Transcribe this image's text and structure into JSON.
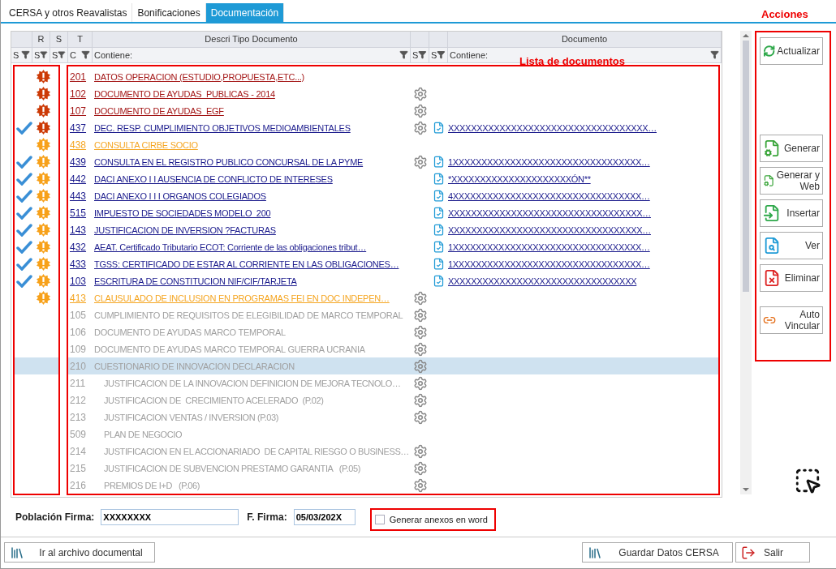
{
  "tabs": [
    {
      "label": "CERSA y otros Reavalistas",
      "selected": false
    },
    {
      "label": "Bonificaciones",
      "selected": false
    },
    {
      "label": "Documentación",
      "selected": true
    }
  ],
  "annotations": {
    "actions": "Acciones",
    "list": "Lista de documentos"
  },
  "table": {
    "columns": [
      {
        "sub": "S"
      },
      {
        "top": "R",
        "sub": "S"
      },
      {
        "top": "S",
        "sub": "S"
      },
      {
        "top": "T",
        "sub": "C"
      },
      {
        "top": "Descri Tipo Documento",
        "sub": "Contiene:"
      },
      {
        "sub": "S"
      },
      {
        "sub": "S"
      },
      {
        "top": "Documento",
        "sub": "Contiene:"
      }
    ],
    "rows": [
      {
        "checked": false,
        "alert": {
          "color": "#cc3a06"
        },
        "code": "201",
        "description": "DATOS OPERACION (ESTUDIO,PROPUESTA,ETC...)",
        "kind": "missing",
        "gear": false,
        "selected": false
      },
      {
        "checked": false,
        "alert": {
          "color": "#cc3a06"
        },
        "code": "102",
        "description": "DOCUMENTO DE AYUDAS  PUBLICAS - 2014",
        "kind": "missing",
        "gear": true,
        "selected": false
      },
      {
        "checked": false,
        "alert": {
          "color": "#cc3a06"
        },
        "code": "107",
        "description": "DOCUMENTO DE AYUDAS  EGF",
        "kind": "missing",
        "gear": true,
        "selected": false
      },
      {
        "checked": true,
        "alert": {
          "color": "#cc3a06"
        },
        "code": "437",
        "description": "DEC. RESP. CUMPLIMIENTO OBJETIVOS MEDIOAMBIENTALES",
        "kind": "received",
        "gear": true,
        "document": "XXXXXXXXXXXXXXXXXXXXXXXXXXXXXXXXXXX…",
        "selected": false
      },
      {
        "checked": false,
        "alert": {
          "color": "#f7a11a"
        },
        "code": "438",
        "description": "CONSULTA CIRBE SOCIO",
        "kind": "pending",
        "gear": false,
        "selected": false
      },
      {
        "checked": true,
        "alert": {
          "color": "#f7a11a"
        },
        "code": "439",
        "description": "CONSULTA EN EL REGISTRO PUBLICO CONCURSAL DE LA PYME",
        "kind": "received",
        "gear": true,
        "document": "1XXXXXXXXXXXXXXXXXXXXXXXXXXXXXXXXX…",
        "selected": false
      },
      {
        "checked": true,
        "alert": {
          "color": "#f7a11a"
        },
        "code": "442",
        "description": "DACI ANEXO I I AUSENCIA DE CONFLICTO DE INTERESES",
        "kind": "received",
        "gear": false,
        "document": "*XXXXXXXXXXXXXXXXXXXXXÓN**",
        "selected": false
      },
      {
        "checked": true,
        "alert": {
          "color": "#f7a11a"
        },
        "code": "443",
        "description": "DACI ANEXO I I I ORGANOS COLEGIADOS",
        "kind": "received",
        "gear": false,
        "document": "4XXXXXXXXXXXXXXXXXXXXXXXXXXXXXXXXX…",
        "selected": false
      },
      {
        "checked": true,
        "alert": {
          "color": "#f7a11a"
        },
        "code": "515",
        "description": "IMPUESTO DE SOCIEDADES MODELO  200",
        "kind": "received",
        "gear": false,
        "document": "XXXXXXXXXXXXXXXXXXXXXXXXXXXXXXXXXX…",
        "selected": false
      },
      {
        "checked": true,
        "alert": {
          "color": "#f7a11a"
        },
        "code": "143",
        "description": "JUSTIFICACION DE INVERSION ?FACTURAS",
        "kind": "received",
        "gear": false,
        "document": "XXXXXXXXXXXXXXXXXXXXXXXXXXXXXXXXXX…",
        "selected": false
      },
      {
        "checked": true,
        "alert": {
          "color": "#f7a11a"
        },
        "code": "432",
        "description": "AEAT. Certificado Tributario ECOT: Corriente de las obligaciones tribut…",
        "kind": "received",
        "gear": false,
        "document": "1XXXXXXXXXXXXXXXXXXXXXXXXXXXXXXXXX…",
        "selected": false
      },
      {
        "checked": true,
        "alert": {
          "color": "#f7a11a"
        },
        "code": "433",
        "description": "TGSS: CERTIFICADO DE ESTAR AL CORRIENTE EN LAS OBLIGACIONES…",
        "kind": "received",
        "gear": false,
        "document": "1XXXXXXXXXXXXXXXXXXXXXXXXXXXXXXXXX…",
        "selected": false
      },
      {
        "checked": true,
        "alert": {
          "color": "#f7a11a"
        },
        "code": "103",
        "description": "ESCRITURA DE CONSTITUCION NIF/CIF/TARJETA",
        "kind": "received",
        "gear": false,
        "document": "XXXXXXXXXXXXXXXXXXXXXXXXXXXXXXXXX",
        "selected": false
      },
      {
        "checked": false,
        "alert": {
          "color": "#f7a11a"
        },
        "code": "413",
        "description": "CLAUSULADO DE INCLUSION EN PROGRAMAS FEI EN DOC INDEPEN…",
        "kind": "pending",
        "gear": true,
        "selected": false
      },
      {
        "checked": false,
        "code": "105",
        "description": "CUMPLIMIENTO DE REQUISITOS DE ELEGIBILIDAD DE MARCO TEMPORAL",
        "kind": "inactive",
        "gear": true,
        "selected": false
      },
      {
        "checked": false,
        "code": "106",
        "description": "DOCUMENTO DE AYUDAS MARCO TEMPORAL",
        "kind": "inactive",
        "gear": true,
        "selected": false
      },
      {
        "checked": false,
        "code": "109",
        "description": "DOCUMENTO DE AYUDAS MARCO TEMPORAL GUERRA UCRANIA",
        "kind": "inactive",
        "gear": true,
        "selected": false
      },
      {
        "checked": false,
        "code": "210",
        "description": "CUESTIONARIO DE INNOVACION DECLARACION",
        "kind": "inactive",
        "gear": true,
        "selected": true,
        "children": [
          {
            "checked": false,
            "code": "211",
            "description": "JUSTIFICACION DE LA INNOVACION DEFINICION DE MEJORA TECNOLO…",
            "kind": "inactive",
            "gear": true,
            "selected": false
          },
          {
            "checked": false,
            "code": "212",
            "description": "JUSTIFICACION DE  CRECIMIENTO ACELERADO  (P.02)",
            "kind": "inactive",
            "gear": true,
            "selected": false
          },
          {
            "checked": false,
            "code": "213",
            "description": "JUSTIFICACION VENTAS / INVERSION (P.03)",
            "kind": "inactive",
            "gear": true,
            "selected": false
          },
          {
            "checked": false,
            "code": "509",
            "description": "PLAN DE NEGOCIO",
            "kind": "inactive",
            "gear": false,
            "selected": false
          },
          {
            "checked": false,
            "code": "214",
            "description": "JUSTIFICACION EN EL ACCIONARIADO  DE CAPITAL RIESGO O BUSINESS…",
            "kind": "inactive",
            "gear": true,
            "selected": false
          },
          {
            "checked": false,
            "code": "215",
            "description": "JUSTIFICACION DE SUBVENCION PRESTAMO GARANTIA   (P.05)",
            "kind": "inactive",
            "gear": true,
            "selected": false
          },
          {
            "checked": false,
            "code": "216",
            "description": "PREMIOS DE I+D   (P.06)",
            "kind": "inactive",
            "gear": true,
            "selected": false
          }
        ]
      }
    ]
  },
  "actions": [
    {
      "label": "Actualizar",
      "kind": "refresh"
    },
    {
      "label": "Generar",
      "kind": "generate"
    },
    {
      "label": "Generar y Web",
      "kind": "generate"
    },
    {
      "label": "Insertar",
      "kind": "insert"
    },
    {
      "label": "Ver",
      "kind": "view"
    },
    {
      "label": "Eliminar",
      "kind": "delete"
    },
    {
      "label": "Auto Vincular",
      "kind": "link"
    }
  ],
  "form": {
    "place_label": "Población Firma:",
    "place_value": "XXXXXXXX",
    "date_label": "F. Firma:",
    "date_value": "05/03/202X",
    "word_annexes": {
      "label": "Generar anexos en word",
      "checked": false
    }
  },
  "footer": [
    {
      "label": "Ir al archivo documental",
      "kind": "archive"
    },
    {
      "label": "Guardar Datos CERSA",
      "kind": "save"
    },
    {
      "label": "Salir",
      "kind": "exit"
    }
  ]
}
